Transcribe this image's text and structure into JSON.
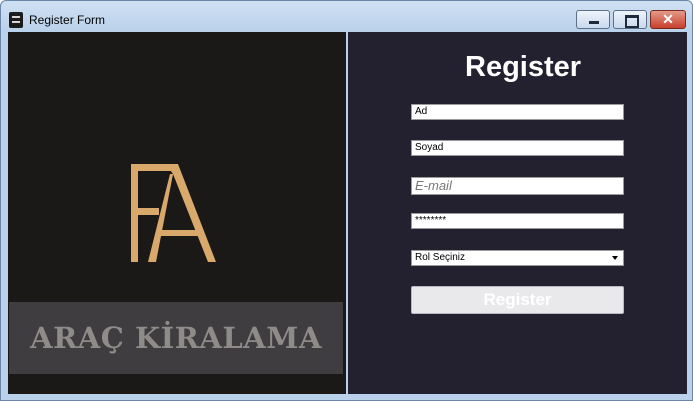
{
  "window": {
    "title": "Register Form",
    "close_glyph": "✕",
    "icons": {
      "app": "app-icon",
      "minimize": "minimize-icon",
      "maximize": "maximize-icon",
      "close": "close-icon"
    }
  },
  "left_panel": {
    "logo_letters": "FA",
    "banner_text": "ARAÇ KİRALAMA",
    "logo_color": "#d9a96b"
  },
  "form": {
    "heading": "Register",
    "fields": {
      "ad": "Ad",
      "soyad": "Soyad",
      "email_placeholder": "E-mail",
      "password": "********",
      "role_select": "Rol Seçiniz"
    },
    "submit_label": "Register"
  }
}
